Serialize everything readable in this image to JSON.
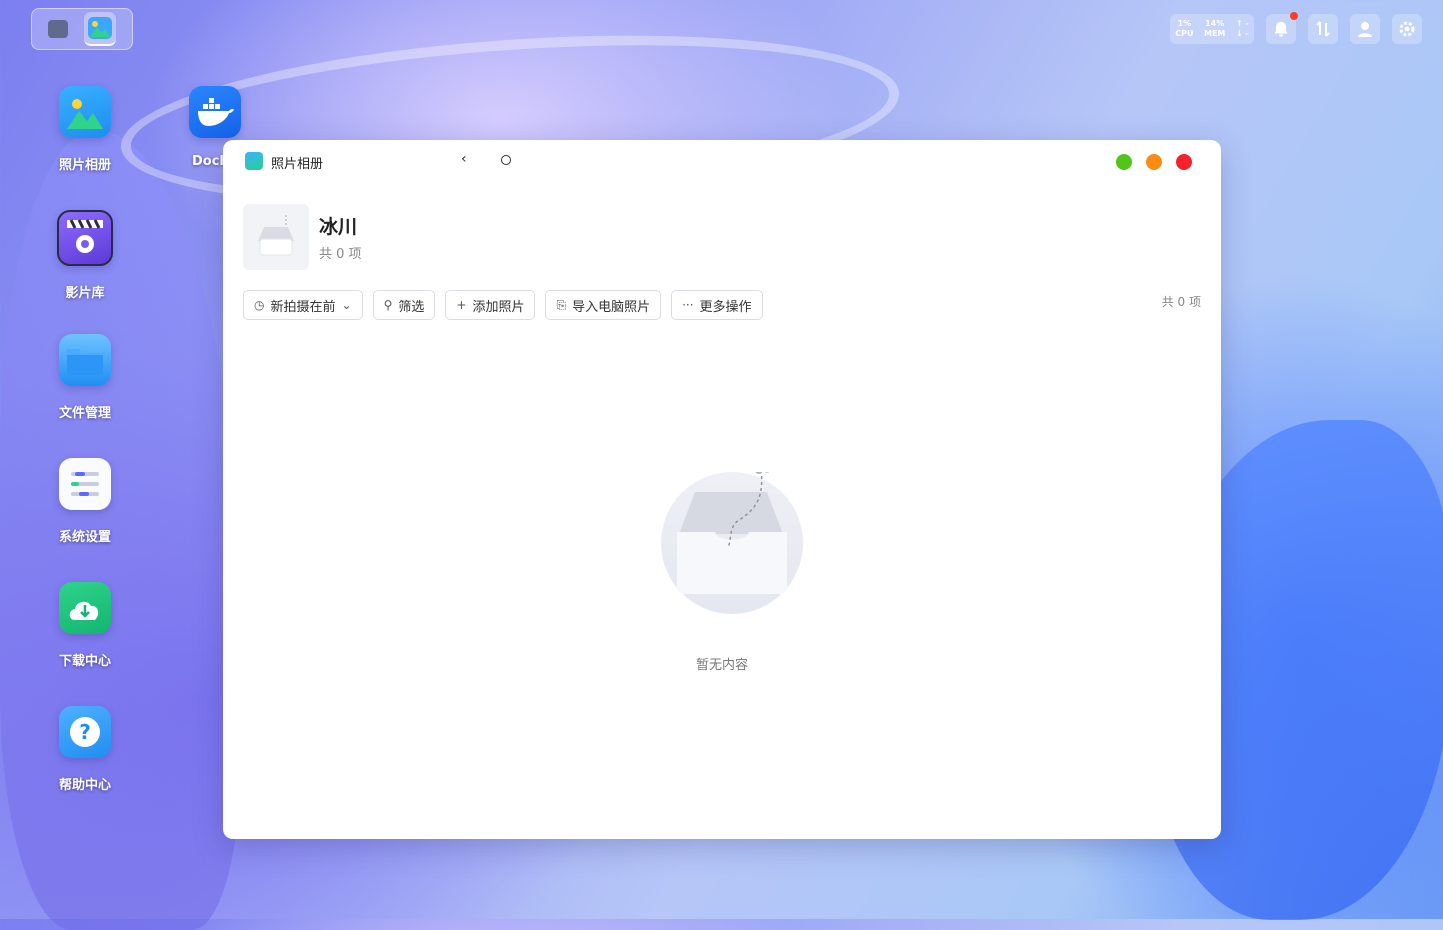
{
  "desktop": {
    "icons": [
      {
        "label": "照片相册",
        "icon": "photos-icon"
      },
      {
        "label": "影片库",
        "icon": "video-library-icon"
      },
      {
        "label": "文件管理",
        "icon": "folder-icon"
      },
      {
        "label": "系统设置",
        "icon": "settings-sliders-icon"
      },
      {
        "label": "下载中心",
        "icon": "download-cloud-icon"
      },
      {
        "label": "帮助中心",
        "icon": "help-icon"
      },
      {
        "label": "Docl",
        "icon": "docker-icon"
      }
    ]
  },
  "status": {
    "cpu_value": "1%",
    "cpu_label": "CPU",
    "mem_value": "14%",
    "mem_label": "MEM",
    "up": "↑ -",
    "down": "↓ -"
  },
  "window": {
    "title": "照片相册",
    "back_glyph": "‹",
    "traffic_lights": {
      "green": "#52c41a",
      "orange": "#fa8c16",
      "red": "#f5222d"
    },
    "album": {
      "name": "冰川",
      "count": "共 0 项"
    },
    "toolbar": {
      "sort": "新拍摄在前",
      "filter": "筛选",
      "add": "添加照片",
      "import": "导入电脑照片",
      "more": "更多操作"
    },
    "total": "共 0 项",
    "empty_text": "暂无内容"
  }
}
